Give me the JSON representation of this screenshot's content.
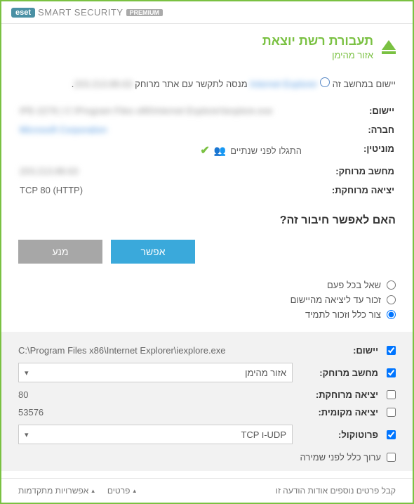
{
  "brand": {
    "eset": "eset",
    "smart": "SMART",
    "security": "SECURITY",
    "premium": "PREMIUM"
  },
  "title": {
    "main": "תעבורת רשת יוצאת",
    "sub": "אזור מהימן"
  },
  "desc": {
    "prefix": "יישום במחשב זה",
    "app": "Internet Explorer",
    "mid": "מנסה לתקשר עם אתר מרוחק",
    "addr": "203.213.88.63"
  },
  "info": {
    "app_label": "יישום:",
    "app_val": "IPE-2276 | C:\\Program Files x86\\Internet Explorer\\iexplore.exe",
    "company_label": "חברה:",
    "company_val": "Microsoft Corporation",
    "rep_label": "מוניטין:",
    "rep_val": "התגלו לפני שנתיים",
    "remote_label": "מחשב מרוחק:",
    "remote_val": "203.213.88.63",
    "port_label": "יציאה מרוחקת:",
    "port_val": "TCP 80 (HTTP)"
  },
  "question": "האם לאפשר חיבור זה?",
  "buttons": {
    "allow": "אפשר",
    "deny": "מנע"
  },
  "radios": {
    "ask": "שאל בכל פעם",
    "remember": "זכור עד ליציאה מהיישום",
    "rule": "צור כלל וזכור לתמיד"
  },
  "adv": {
    "app_label": "יישום:",
    "app_val": "C:\\Program Files x86\\Internet Explorer\\iexplore.exe",
    "remote_label": "מחשב מרוחק:",
    "remote_val": "אזור מהימן",
    "rport_label": "יציאה מרוחקת:",
    "rport_val": "80",
    "lport_label": "יציאה מקומית:",
    "lport_val": "53576",
    "proto_label": "פרוטוקול:",
    "proto_val": "TCP ו-UDP",
    "review": "ערוך כלל לפני שמירה"
  },
  "footer": {
    "more": "קבל פרטים נוספים אודות הודעה זו",
    "details": "פרטים",
    "advanced": "אפשרויות מתקדמות"
  }
}
